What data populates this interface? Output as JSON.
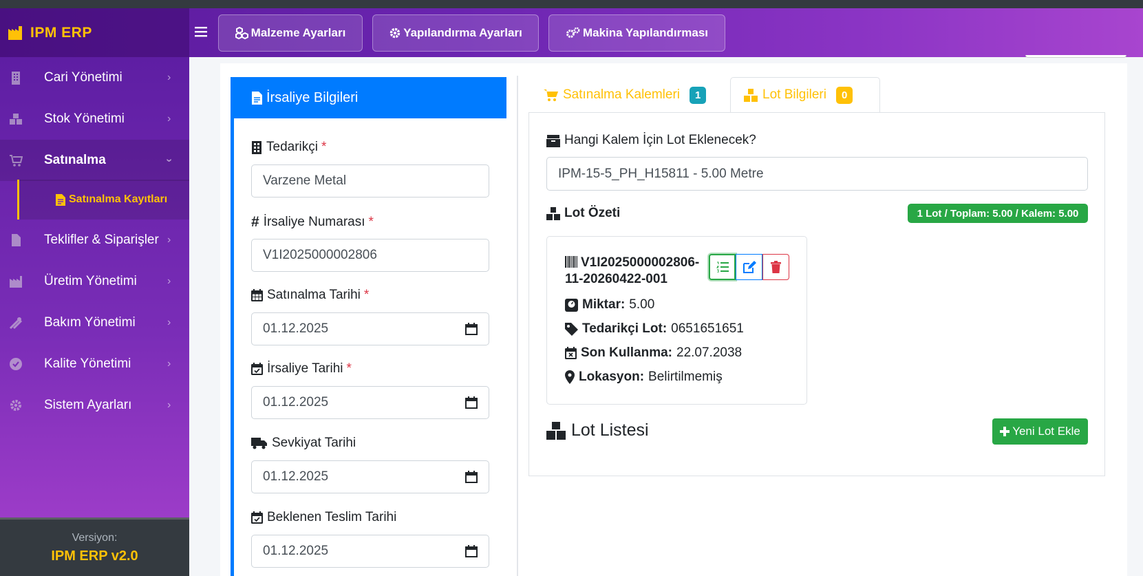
{
  "app": {
    "brand": "IPM ERP"
  },
  "topnav": {
    "buttons": [
      {
        "label": "Malzeme Ayarları",
        "icon": "cubes-icon"
      },
      {
        "label": "Yapılandırma Ayarları",
        "icon": "gear-icon"
      },
      {
        "label": "Makina Yapılandırması",
        "icon": "gears-icon"
      }
    ]
  },
  "sidebar": {
    "items": [
      {
        "label": "Cari Yönetimi",
        "icon": "building-icon"
      },
      {
        "label": "Stok Yönetimi",
        "icon": "boxes-icon"
      },
      {
        "label": "Satınalma",
        "icon": "cart-icon"
      },
      {
        "label": "Teklifler & Siparişler",
        "icon": "document-icon"
      },
      {
        "label": "Üretim Yönetimi",
        "icon": "factory-icon"
      },
      {
        "label": "Bakım Yönetimi",
        "icon": "tools-icon"
      },
      {
        "label": "Kalite Yönetimi",
        "icon": "check-circle-icon"
      },
      {
        "label": "Sistem Ayarları",
        "icon": "gear-icon"
      }
    ],
    "sub_item": "Satınalma Kayıtları",
    "footer": {
      "version_label": "Versiyon:",
      "version": "IPM ERP v2.0"
    }
  },
  "left_panel": {
    "title": "İrsaliye Bilgileri",
    "fields": [
      {
        "label": "Tedarikçi",
        "required": "*",
        "value": "Varzene Metal"
      },
      {
        "label": "İrsaliye Numarası",
        "required": "*",
        "value": "V1I2025000002806"
      },
      {
        "label": "Satınalma Tarihi",
        "required": "*",
        "value": "01.12.2025"
      },
      {
        "label": "İrsaliye Tarihi",
        "required": "*",
        "value": "01.12.2025"
      },
      {
        "label": "Sevkiyat Tarihi",
        "required": "",
        "value": "01.12.2025"
      },
      {
        "label": "Beklenen Teslim Tarihi",
        "required": "",
        "value": "01.12.2025"
      }
    ]
  },
  "tabs": [
    {
      "label": "Satınalma Kalemleri",
      "count": "1"
    },
    {
      "label": "Lot Bilgileri",
      "count": "0"
    }
  ],
  "lot_panel": {
    "question": "Hangi Kalem İçin Lot Eklenecek?",
    "selected_item": "IPM-15-5_PH_H15811 - 5.00 Metre",
    "summary_title": "Lot Özeti",
    "summary_badge": "1 Lot / Toplam: 5.00 / Kalem: 5.00",
    "lot": {
      "code_line1": "V1I2025000002806-",
      "code_line2": "11-20260422-001",
      "quantity_label": "Miktar:",
      "quantity": "5.00",
      "supplier_lot_label": "Tedarikçi Lot:",
      "supplier_lot": "0651651651",
      "expiry_label": "Son Kullanma:",
      "expiry": "22.07.2038",
      "location_label": "Lokasyon:",
      "location": "Belirtilmemiş"
    },
    "list_title": "Lot Listesi",
    "add_button": "Yeni Lot Ekle"
  },
  "colors": {
    "primary": "#007bff",
    "warning": "#ffc107",
    "success": "#28a745",
    "danger": "#dc3545",
    "info": "#17a2b8",
    "sidebar": "#6a24b0"
  }
}
